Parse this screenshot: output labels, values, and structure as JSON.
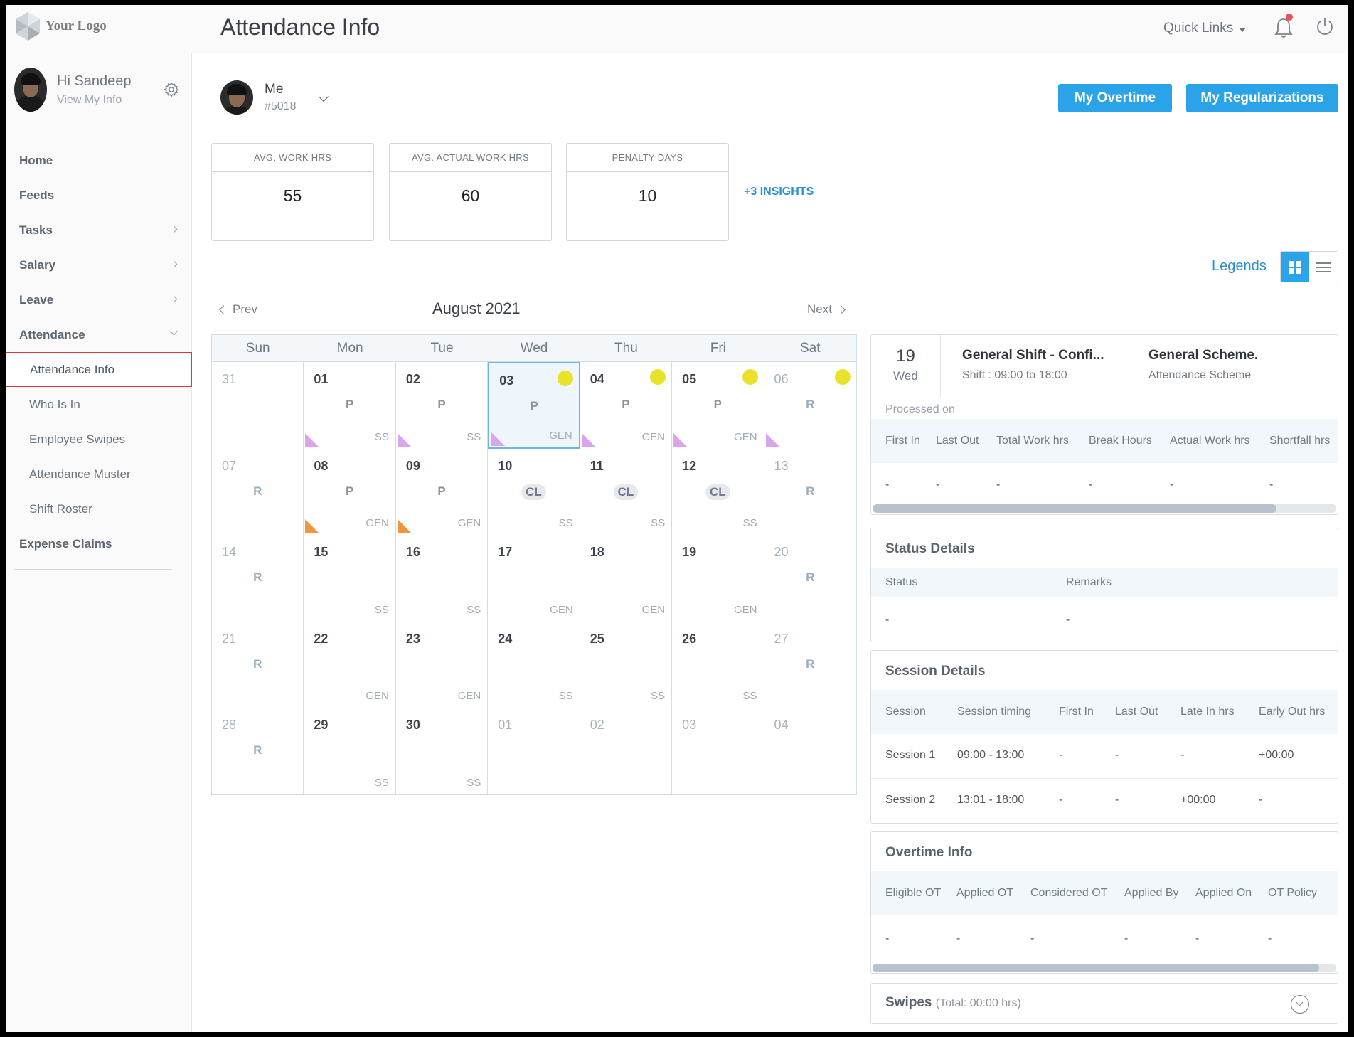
{
  "app": {
    "logo_text": "Your Logo",
    "page_title": "Attendance Info",
    "quick_links": "Quick Links"
  },
  "sidebar": {
    "greeting": "Hi Sandeep",
    "view_info": "View My Info",
    "items": [
      {
        "label": "Home"
      },
      {
        "label": "Feeds"
      },
      {
        "label": "Tasks"
      },
      {
        "label": "Salary"
      },
      {
        "label": "Leave"
      },
      {
        "label": "Attendance"
      }
    ],
    "sub_items": [
      {
        "label": "Attendance Info",
        "active": true
      },
      {
        "label": "Who Is In"
      },
      {
        "label": "Employee Swipes"
      },
      {
        "label": "Attendance Muster"
      },
      {
        "label": "Shift Roster"
      }
    ],
    "expense": "Expense Claims"
  },
  "employee": {
    "name": "Me",
    "id": "#5018"
  },
  "buttons": {
    "overtime": "My Overtime",
    "regularizations": "My Regularizations"
  },
  "stats": [
    {
      "label": "AVG. WORK HRS",
      "value": "55"
    },
    {
      "label": "AVG. ACTUAL WORK HRS",
      "value": "60"
    },
    {
      "label": "PENALTY DAYS",
      "value": "10"
    }
  ],
  "insights": "+3 INSIGHTS",
  "legends": "Legends",
  "calendar": {
    "prev": "Prev",
    "next": "Next",
    "month": "August 2021",
    "weekdays": [
      "Sun",
      "Mon",
      "Tue",
      "Wed",
      "Thu",
      "Fri",
      "Sat"
    ],
    "weeks": [
      [
        {
          "d": "31",
          "muted": true
        },
        {
          "d": "01",
          "status": "P",
          "shift": "SS",
          "tri": "pink"
        },
        {
          "d": "02",
          "status": "P",
          "shift": "SS",
          "tri": "pink"
        },
        {
          "d": "03",
          "status": "P",
          "shift": "GEN",
          "tri": "pink",
          "dot": true,
          "selected": true
        },
        {
          "d": "04",
          "status": "P",
          "shift": "GEN",
          "tri": "pink",
          "dot": true
        },
        {
          "d": "05",
          "status": "P",
          "shift": "GEN",
          "tri": "pink",
          "dot": true
        },
        {
          "d": "06",
          "status": "R",
          "tri": "pink",
          "dot": true,
          "muted": true
        }
      ],
      [
        {
          "d": "07",
          "status": "R",
          "muted": true
        },
        {
          "d": "08",
          "status": "P",
          "shift": "GEN",
          "tri": "orange"
        },
        {
          "d": "09",
          "status": "P",
          "shift": "GEN",
          "tri": "orange"
        },
        {
          "d": "10",
          "status": "CL",
          "shift": "SS"
        },
        {
          "d": "11",
          "status": "CL",
          "shift": "SS"
        },
        {
          "d": "12",
          "status": "CL",
          "shift": "SS"
        },
        {
          "d": "13",
          "status": "R",
          "muted": true
        }
      ],
      [
        {
          "d": "14",
          "status": "R",
          "muted": true
        },
        {
          "d": "15",
          "shift": "SS"
        },
        {
          "d": "16",
          "shift": "SS"
        },
        {
          "d": "17",
          "shift": "GEN"
        },
        {
          "d": "18",
          "shift": "GEN"
        },
        {
          "d": "19",
          "shift": "GEN"
        },
        {
          "d": "20",
          "status": "R",
          "muted": true
        }
      ],
      [
        {
          "d": "21",
          "status": "R",
          "muted": true
        },
        {
          "d": "22",
          "shift": "GEN"
        },
        {
          "d": "23",
          "shift": "GEN"
        },
        {
          "d": "24",
          "shift": "SS"
        },
        {
          "d": "25",
          "shift": "SS"
        },
        {
          "d": "26",
          "shift": "SS"
        },
        {
          "d": "27",
          "status": "R",
          "muted": true
        }
      ],
      [
        {
          "d": "28",
          "status": "R",
          "muted": true
        },
        {
          "d": "29",
          "shift": "SS"
        },
        {
          "d": "30",
          "shift": "SS"
        },
        {
          "d": "01",
          "muted": true
        },
        {
          "d": "02",
          "muted": true
        },
        {
          "d": "03",
          "muted": true
        },
        {
          "d": "04",
          "muted": true
        }
      ]
    ]
  },
  "day_detail": {
    "day": "19",
    "weekday": "Wed",
    "shift_name": "General Shift - Confi...",
    "shift_time": "Shift : 09:00 to 18:00",
    "scheme_name": "General Scheme.",
    "scheme_sub": "Attendance Scheme",
    "processed": "Processed on",
    "columns": [
      "First In",
      "Last Out",
      "Total Work hrs",
      "Break Hours",
      "Actual Work hrs",
      "Shortfall hrs"
    ],
    "values": [
      "-",
      "-",
      "-",
      "-",
      "-",
      "-"
    ]
  },
  "status_details": {
    "title": "Status Details",
    "columns": [
      "Status",
      "Remarks"
    ],
    "values": [
      "-",
      "-"
    ]
  },
  "session_details": {
    "title": "Session Details",
    "columns": [
      "Session",
      "Session timing",
      "First In",
      "Last Out",
      "Late In hrs",
      "Early Out hrs"
    ],
    "rows": [
      [
        "Session 1",
        "09:00 - 13:00",
        "-",
        "-",
        "-",
        "+00:00"
      ],
      [
        "Session 2",
        "13:01 - 18:00",
        "-",
        "-",
        "+00:00",
        "-"
      ]
    ]
  },
  "overtime_info": {
    "title": "Overtime Info",
    "columns": [
      "Eligible OT",
      "Applied OT",
      "Considered OT",
      "Applied By",
      "Applied On",
      "OT Policy"
    ],
    "values": [
      "-",
      "-",
      "-",
      "-",
      "-",
      "-"
    ]
  },
  "swipes": {
    "title": "Swipes",
    "total": "(Total: 00:00 hrs)"
  },
  "colors": {
    "accent": "#2ba3e8",
    "present_dot": "#e8e22a",
    "pink_flag": "#d9a6ee",
    "orange_flag": "#f0963c"
  }
}
